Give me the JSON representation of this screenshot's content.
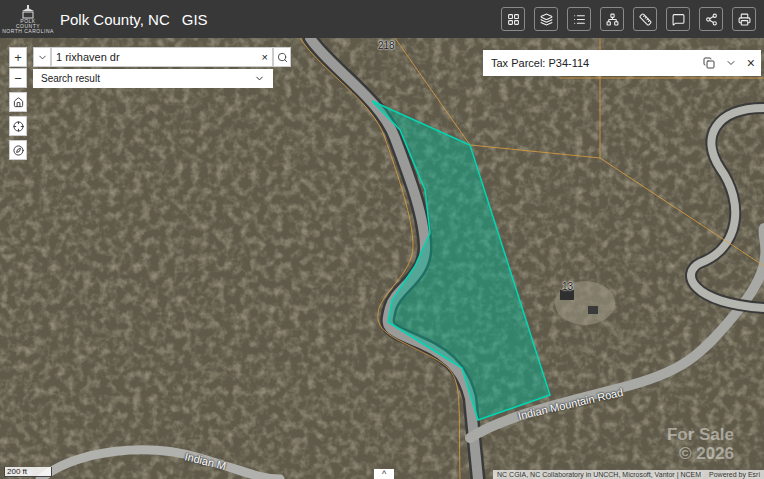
{
  "header": {
    "logo_lines": [
      "POLK",
      "COUNTY",
      "NORTH CAROLINA"
    ],
    "title": "Polk County, NC",
    "subtitle": "GIS"
  },
  "search": {
    "value": "1 rixhaven dr",
    "clear": "×",
    "result_label": "Search result"
  },
  "zoom": {
    "in": "+",
    "out": "−"
  },
  "popup": {
    "title": "Tax Parcel: P34-114",
    "close": "×"
  },
  "map_labels": [
    {
      "text": "218"
    },
    {
      "text": "13"
    },
    {
      "text": "Indian Mountain Road"
    },
    {
      "text": "Indian M"
    }
  ],
  "watermark": [
    "For Sale",
    "© 2026"
  ],
  "scale": "200 ft",
  "attribution": "NC CGIA, NC Collaboratory in UNCCH, Microsoft, Vantor | NCEM",
  "powered": "Powered by Esri",
  "collapse": "^"
}
